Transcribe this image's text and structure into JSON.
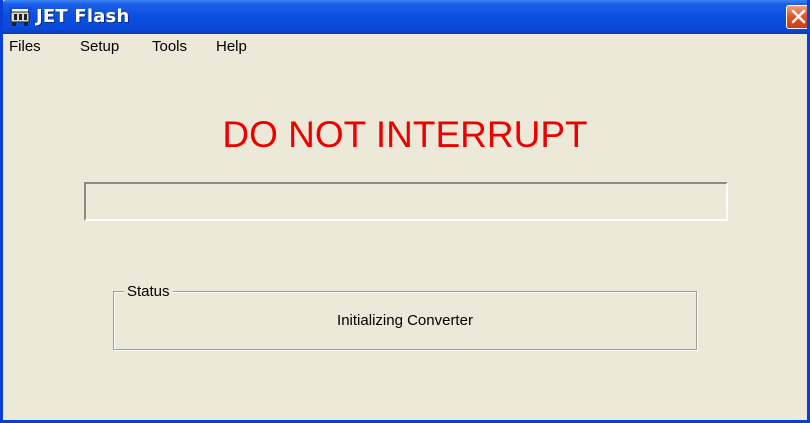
{
  "window": {
    "title": "JET Flash",
    "icon": "jet-flash-app-icon",
    "close_icon": "close-icon"
  },
  "menu": {
    "items": [
      "Files",
      "Setup",
      "Tools",
      "Help"
    ]
  },
  "main": {
    "warning": "DO NOT INTERRUPT",
    "progress_fraction": 0,
    "status_label": "Status",
    "status_text": "Initializing Converter"
  },
  "colors": {
    "warning_text": "#ee0000",
    "titlebar": "#0a4fe0",
    "window_bg": "#ece9d8"
  }
}
